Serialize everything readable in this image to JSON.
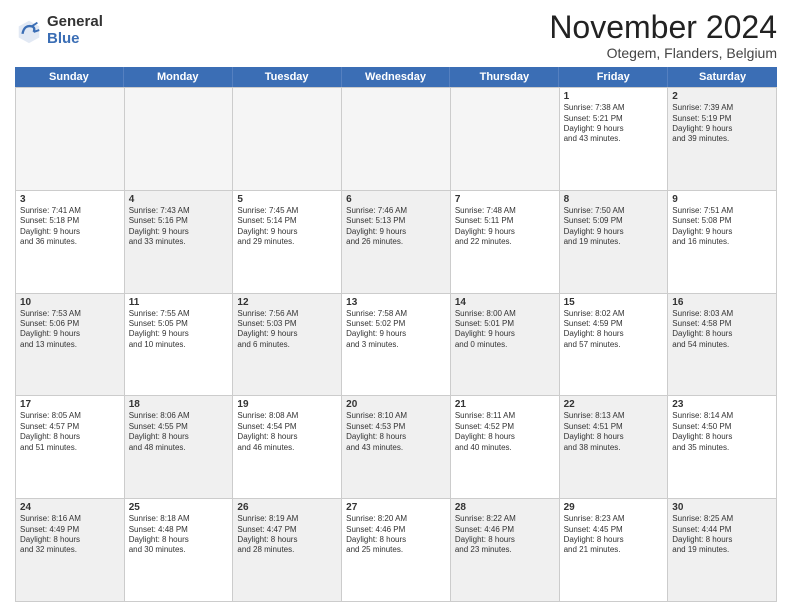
{
  "logo": {
    "general": "General",
    "blue": "Blue"
  },
  "header": {
    "month": "November 2024",
    "location": "Otegem, Flanders, Belgium"
  },
  "weekdays": [
    "Sunday",
    "Monday",
    "Tuesday",
    "Wednesday",
    "Thursday",
    "Friday",
    "Saturday"
  ],
  "weeks": [
    [
      {
        "day": "",
        "info": "",
        "shade": "empty"
      },
      {
        "day": "",
        "info": "",
        "shade": "empty"
      },
      {
        "day": "",
        "info": "",
        "shade": "empty"
      },
      {
        "day": "",
        "info": "",
        "shade": "empty"
      },
      {
        "day": "",
        "info": "",
        "shade": "empty"
      },
      {
        "day": "1",
        "info": "Sunrise: 7:38 AM\nSunset: 5:21 PM\nDaylight: 9 hours\nand 43 minutes.",
        "shade": ""
      },
      {
        "day": "2",
        "info": "Sunrise: 7:39 AM\nSunset: 5:19 PM\nDaylight: 9 hours\nand 39 minutes.",
        "shade": "shaded"
      }
    ],
    [
      {
        "day": "3",
        "info": "Sunrise: 7:41 AM\nSunset: 5:18 PM\nDaylight: 9 hours\nand 36 minutes.",
        "shade": ""
      },
      {
        "day": "4",
        "info": "Sunrise: 7:43 AM\nSunset: 5:16 PM\nDaylight: 9 hours\nand 33 minutes.",
        "shade": "shaded"
      },
      {
        "day": "5",
        "info": "Sunrise: 7:45 AM\nSunset: 5:14 PM\nDaylight: 9 hours\nand 29 minutes.",
        "shade": ""
      },
      {
        "day": "6",
        "info": "Sunrise: 7:46 AM\nSunset: 5:13 PM\nDaylight: 9 hours\nand 26 minutes.",
        "shade": "shaded"
      },
      {
        "day": "7",
        "info": "Sunrise: 7:48 AM\nSunset: 5:11 PM\nDaylight: 9 hours\nand 22 minutes.",
        "shade": ""
      },
      {
        "day": "8",
        "info": "Sunrise: 7:50 AM\nSunset: 5:09 PM\nDaylight: 9 hours\nand 19 minutes.",
        "shade": "shaded"
      },
      {
        "day": "9",
        "info": "Sunrise: 7:51 AM\nSunset: 5:08 PM\nDaylight: 9 hours\nand 16 minutes.",
        "shade": ""
      }
    ],
    [
      {
        "day": "10",
        "info": "Sunrise: 7:53 AM\nSunset: 5:06 PM\nDaylight: 9 hours\nand 13 minutes.",
        "shade": "shaded"
      },
      {
        "day": "11",
        "info": "Sunrise: 7:55 AM\nSunset: 5:05 PM\nDaylight: 9 hours\nand 10 minutes.",
        "shade": ""
      },
      {
        "day": "12",
        "info": "Sunrise: 7:56 AM\nSunset: 5:03 PM\nDaylight: 9 hours\nand 6 minutes.",
        "shade": "shaded"
      },
      {
        "day": "13",
        "info": "Sunrise: 7:58 AM\nSunset: 5:02 PM\nDaylight: 9 hours\nand 3 minutes.",
        "shade": ""
      },
      {
        "day": "14",
        "info": "Sunrise: 8:00 AM\nSunset: 5:01 PM\nDaylight: 9 hours\nand 0 minutes.",
        "shade": "shaded"
      },
      {
        "day": "15",
        "info": "Sunrise: 8:02 AM\nSunset: 4:59 PM\nDaylight: 8 hours\nand 57 minutes.",
        "shade": ""
      },
      {
        "day": "16",
        "info": "Sunrise: 8:03 AM\nSunset: 4:58 PM\nDaylight: 8 hours\nand 54 minutes.",
        "shade": "shaded"
      }
    ],
    [
      {
        "day": "17",
        "info": "Sunrise: 8:05 AM\nSunset: 4:57 PM\nDaylight: 8 hours\nand 51 minutes.",
        "shade": ""
      },
      {
        "day": "18",
        "info": "Sunrise: 8:06 AM\nSunset: 4:55 PM\nDaylight: 8 hours\nand 48 minutes.",
        "shade": "shaded"
      },
      {
        "day": "19",
        "info": "Sunrise: 8:08 AM\nSunset: 4:54 PM\nDaylight: 8 hours\nand 46 minutes.",
        "shade": ""
      },
      {
        "day": "20",
        "info": "Sunrise: 8:10 AM\nSunset: 4:53 PM\nDaylight: 8 hours\nand 43 minutes.",
        "shade": "shaded"
      },
      {
        "day": "21",
        "info": "Sunrise: 8:11 AM\nSunset: 4:52 PM\nDaylight: 8 hours\nand 40 minutes.",
        "shade": ""
      },
      {
        "day": "22",
        "info": "Sunrise: 8:13 AM\nSunset: 4:51 PM\nDaylight: 8 hours\nand 38 minutes.",
        "shade": "shaded"
      },
      {
        "day": "23",
        "info": "Sunrise: 8:14 AM\nSunset: 4:50 PM\nDaylight: 8 hours\nand 35 minutes.",
        "shade": ""
      }
    ],
    [
      {
        "day": "24",
        "info": "Sunrise: 8:16 AM\nSunset: 4:49 PM\nDaylight: 8 hours\nand 32 minutes.",
        "shade": "shaded"
      },
      {
        "day": "25",
        "info": "Sunrise: 8:18 AM\nSunset: 4:48 PM\nDaylight: 8 hours\nand 30 minutes.",
        "shade": ""
      },
      {
        "day": "26",
        "info": "Sunrise: 8:19 AM\nSunset: 4:47 PM\nDaylight: 8 hours\nand 28 minutes.",
        "shade": "shaded"
      },
      {
        "day": "27",
        "info": "Sunrise: 8:20 AM\nSunset: 4:46 PM\nDaylight: 8 hours\nand 25 minutes.",
        "shade": ""
      },
      {
        "day": "28",
        "info": "Sunrise: 8:22 AM\nSunset: 4:46 PM\nDaylight: 8 hours\nand 23 minutes.",
        "shade": "shaded"
      },
      {
        "day": "29",
        "info": "Sunrise: 8:23 AM\nSunset: 4:45 PM\nDaylight: 8 hours\nand 21 minutes.",
        "shade": ""
      },
      {
        "day": "30",
        "info": "Sunrise: 8:25 AM\nSunset: 4:44 PM\nDaylight: 8 hours\nand 19 minutes.",
        "shade": "shaded"
      }
    ]
  ]
}
